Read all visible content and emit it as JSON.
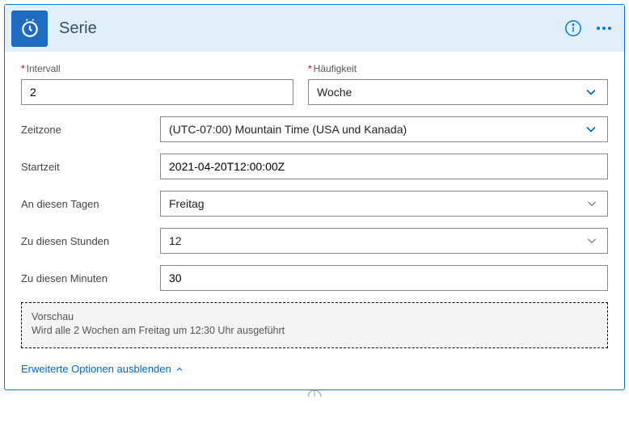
{
  "header": {
    "title": "Serie"
  },
  "fields": {
    "interval": {
      "label": "Intervall",
      "value": "2"
    },
    "frequency": {
      "label": "Häufigkeit",
      "value": "Woche"
    },
    "timezone": {
      "label": "Zeitzone",
      "value": "(UTC-07:00) Mountain Time (USA und  Kanada)"
    },
    "starttime": {
      "label": "Startzeit",
      "value": "2021-04-20T12:00:00Z"
    },
    "days": {
      "label": "An diesen Tagen",
      "value": "Freitag"
    },
    "hours": {
      "label": "Zu diesen Stunden",
      "value": "12"
    },
    "minutes": {
      "label": "Zu diesen Minuten",
      "value": "30"
    }
  },
  "preview": {
    "title": "Vorschau",
    "text": "Wird alle 2 Wochen am Freitag um 12:30 Uhr ausgeführt"
  },
  "advanced_link": "Erweiterte Optionen ausblenden"
}
